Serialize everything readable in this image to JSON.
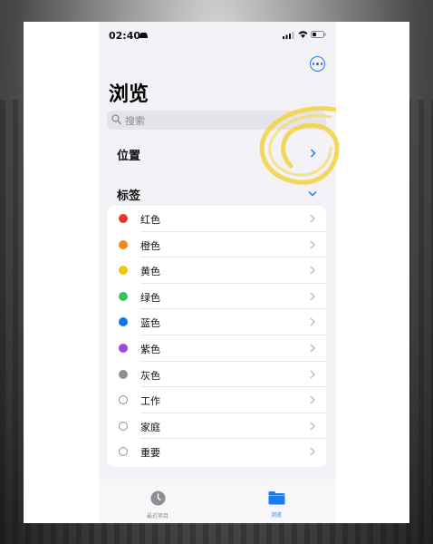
{
  "status_bar": {
    "time": "02:40"
  },
  "header": {
    "title": "浏览"
  },
  "search": {
    "placeholder": "搜索"
  },
  "sections": {
    "locations": "位置",
    "tags": "标签"
  },
  "tags": [
    {
      "label": "红色",
      "color": "#e8352b"
    },
    {
      "label": "橙色",
      "color": "#f08a17"
    },
    {
      "label": "黄色",
      "color": "#f3c70b"
    },
    {
      "label": "绿色",
      "color": "#33c458"
    },
    {
      "label": "蓝色",
      "color": "#1a73e8"
    },
    {
      "label": "紫色",
      "color": "#a54ad6"
    },
    {
      "label": "灰色",
      "color": "#8e8e93"
    },
    {
      "label": "工作",
      "color": ""
    },
    {
      "label": "家庭",
      "color": ""
    },
    {
      "label": "重要",
      "color": ""
    }
  ],
  "tab_bar": {
    "recents": "最近项目",
    "browse": "浏览"
  },
  "colors": {
    "accent": "#1a7cf2",
    "highlight": "#f5d23c"
  }
}
